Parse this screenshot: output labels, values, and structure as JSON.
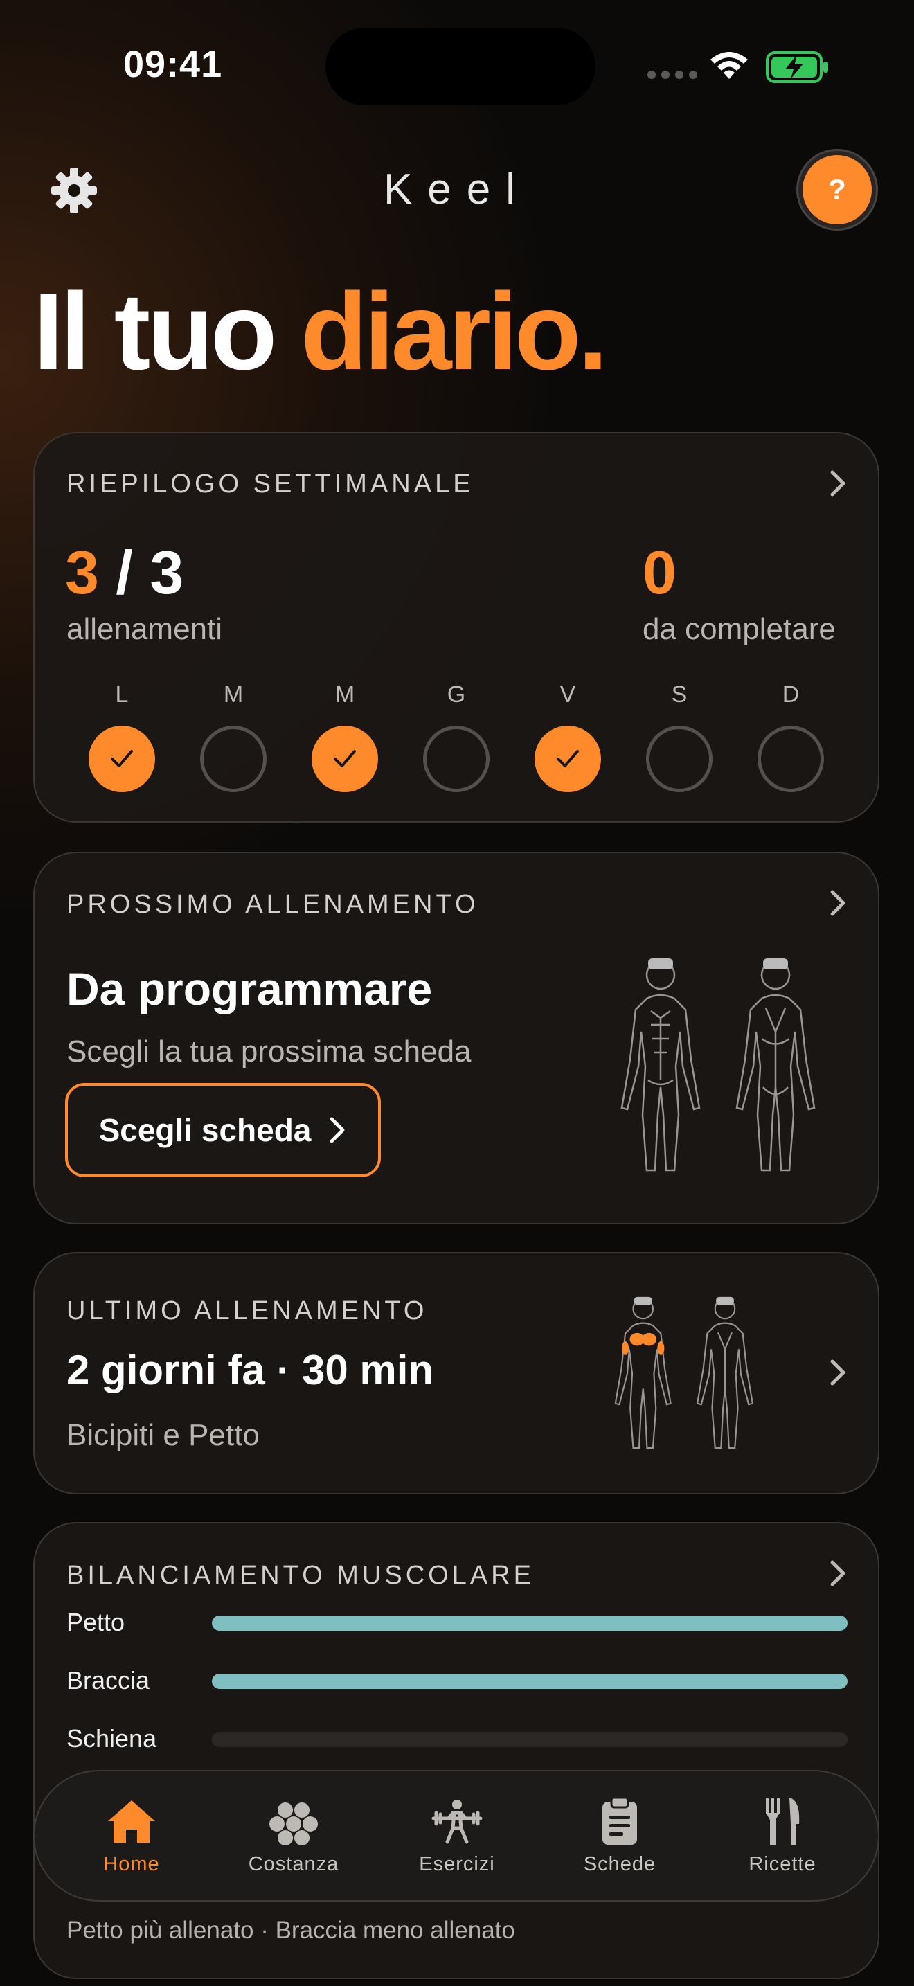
{
  "status": {
    "time": "09:41",
    "battery_color": "#34c759"
  },
  "header": {
    "app_name": "Keel",
    "help_label": "?",
    "settings_icon": "gear-icon"
  },
  "headline": {
    "part1": "Il tuo ",
    "accent": "diario."
  },
  "colors": {
    "accent": "#ff8a2b",
    "bar": "#7fbec1"
  },
  "weekly": {
    "title": "RIEPILOGO SETTIMANALE",
    "done": "3",
    "separator": " / ",
    "total": "3",
    "done_label": "allenamenti",
    "remaining": "0",
    "remaining_label": "da completare",
    "days": [
      {
        "label": "L",
        "done": true
      },
      {
        "label": "M",
        "done": false
      },
      {
        "label": "M",
        "done": true
      },
      {
        "label": "G",
        "done": false
      },
      {
        "label": "V",
        "done": true
      },
      {
        "label": "S",
        "done": false
      },
      {
        "label": "D",
        "done": false
      }
    ]
  },
  "next": {
    "title": "PROSSIMO ALLENAMENTO",
    "heading": "Da programmare",
    "subtitle": "Scegli la tua prossima scheda",
    "button_label": "Scegli scheda"
  },
  "last": {
    "title": "ULTIMO ALLENAMENTO",
    "summary": "2 giorni fa · 30 min",
    "muscles": "Bicipiti e Petto"
  },
  "balance": {
    "title": "BILANCIAMENTO MUSCOLARE",
    "rows": [
      {
        "label": "Petto",
        "level": 1.0
      },
      {
        "label": "Braccia",
        "level": 1.0
      },
      {
        "label": "Schiena",
        "level": 0.0
      }
    ],
    "footer": "Petto più allenato · Braccia meno allenato"
  },
  "tabs": [
    {
      "label": "Home",
      "icon": "home-icon",
      "active": true
    },
    {
      "label": "Costanza",
      "icon": "flower-icon",
      "active": false
    },
    {
      "label": "Esercizi",
      "icon": "weightlifter-icon",
      "active": false
    },
    {
      "label": "Schede",
      "icon": "clipboard-icon",
      "active": false
    },
    {
      "label": "Ricette",
      "icon": "cutlery-icon",
      "active": false
    }
  ]
}
